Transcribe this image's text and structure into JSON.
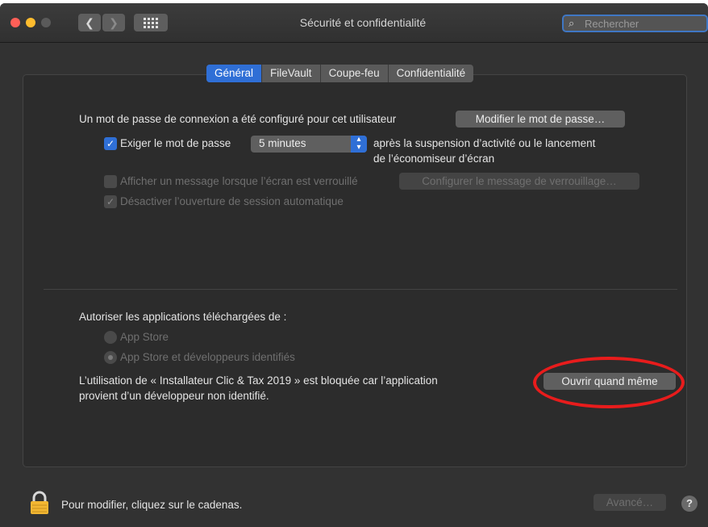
{
  "window": {
    "title": "Sécurité et confidentialité",
    "search_placeholder": "Rechercher"
  },
  "toolbar": {
    "back_icon": "chevron-left-icon",
    "forward_icon": "chevron-right-icon",
    "grid_icon": "grid-icon"
  },
  "tabs": [
    {
      "label": "Général",
      "active": true
    },
    {
      "label": "FileVault",
      "active": false
    },
    {
      "label": "Coupe-feu",
      "active": false
    },
    {
      "label": "Confidentialité",
      "active": false
    }
  ],
  "general": {
    "password_set_text": "Un mot de passe de connexion a été configuré pour cet utilisateur",
    "change_password_button": "Modifier le mot de passe…",
    "require_password": {
      "label": "Exiger le mot de passe",
      "checked": true,
      "delay_value": "5 minutes",
      "after_text_line1": "après la suspension d’activité ou le lancement",
      "after_text_line2": "de l’économiseur d’écran"
    },
    "show_message": {
      "label": "Afficher un message lorsque l’écran est verrouillé",
      "checked": false,
      "button": "Configurer le message de verrouillage…"
    },
    "disable_auto_login": {
      "label": "Désactiver l’ouverture de session automatique",
      "checked": true
    }
  },
  "apps": {
    "heading": "Autoriser les applications téléchargées de :",
    "options": [
      {
        "label": "App Store",
        "selected": false
      },
      {
        "label": "App Store et développeurs identifiés",
        "selected": true
      }
    ],
    "blocked_line1": "L’utilisation de « Installateur Clic & Tax 2019 » est bloquée car l’application",
    "blocked_line2": "provient d’un développeur non identifié.",
    "open_anyway_button": "Ouvrir quand même"
  },
  "footer": {
    "lock_text": "Pour modifier, cliquez sur le cadenas.",
    "advanced_button": "Avancé…",
    "help_label": "?"
  },
  "colors": {
    "accent": "#2f6fd6",
    "annotation_ring": "#e81c1c",
    "lock": "#f2b632"
  }
}
